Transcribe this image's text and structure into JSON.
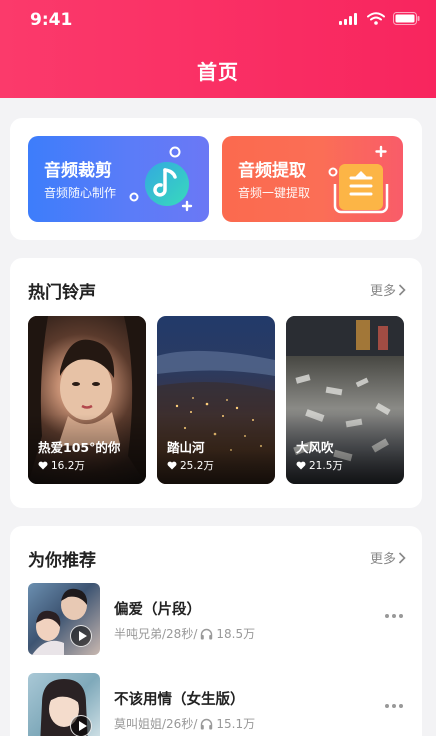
{
  "status_bar": {
    "time": "9:41"
  },
  "header": {
    "title": "首页"
  },
  "tools": [
    {
      "title": "音频裁剪",
      "subtitle": "音频随心制作",
      "icon": "music-note-cut-icon"
    },
    {
      "title": "音频提取",
      "subtitle": "音频一键提取",
      "icon": "audio-extract-icon"
    }
  ],
  "ringtones": {
    "title": "热门铃声",
    "more": "更多",
    "items": [
      {
        "name": "热爱105°的你",
        "likes": "16.2万"
      },
      {
        "name": "踏山河",
        "likes": "25.2万"
      },
      {
        "name": "大风吹",
        "likes": "21.5万"
      }
    ]
  },
  "recommend": {
    "title": "为你推荐",
    "more": "更多",
    "items": [
      {
        "title": "偏爱（片段）",
        "artist_duration": "半吨兄弟/28秒/",
        "plays": "18.5万"
      },
      {
        "title": "不该用情（女生版）",
        "artist_duration": "莫叫姐姐/26秒/",
        "plays": "15.1万"
      }
    ]
  },
  "colors": {
    "header_gradient": [
      "#fb3a6b",
      "#f8255e"
    ],
    "trim_tile": [
      "#3d7dfb",
      "#6b78f5"
    ],
    "extract_tile": [
      "#fb6a4e",
      "#f95c69"
    ]
  }
}
